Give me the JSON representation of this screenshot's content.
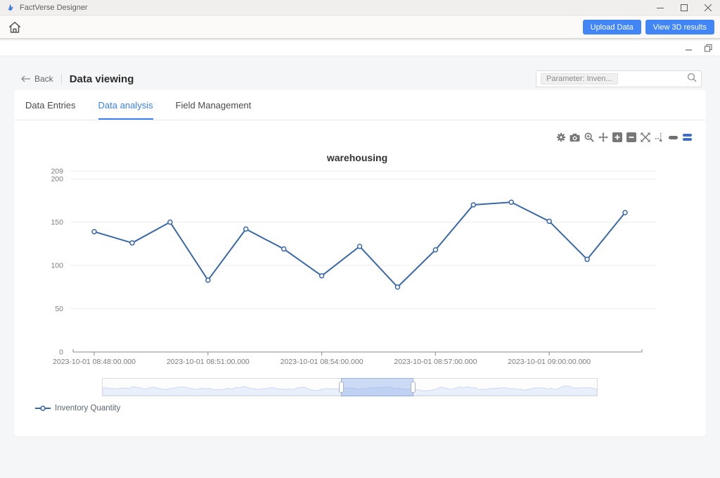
{
  "window": {
    "title": "FactVerse Designer"
  },
  "toolbar": {
    "upload_label": "Upload Data",
    "view3d_label": "View 3D results"
  },
  "header": {
    "back_label": "Back",
    "page_title": "Data viewing",
    "search_chip": "Parameter: Inven..."
  },
  "tabs": [
    {
      "label": "Data Entries"
    },
    {
      "label": "Data analysis"
    },
    {
      "label": "Field Management"
    }
  ],
  "modebar_icons": [
    "settings",
    "camera",
    "zoom",
    "pan",
    "zoom-in",
    "zoom-out",
    "autoscale",
    "toggle-spikelines",
    "hover-closest",
    "hover-compare"
  ],
  "colors": {
    "accent": "#4285f4",
    "active_tab": "#3b7ff0",
    "line": "#3a68a8",
    "grid": "#ededed",
    "axis": "#888888",
    "tick_text": "#7b7b7b"
  },
  "chart_data": {
    "type": "line",
    "title": "warehousing",
    "legend": "Inventory Quantity",
    "x": [
      "2023-10-01 08:48:00.000",
      "2023-10-01 08:49:00.000",
      "2023-10-01 08:50:00.000",
      "2023-10-01 08:51:00.000",
      "2023-10-01 08:52:00.000",
      "2023-10-01 08:53:00.000",
      "2023-10-01 08:54:00.000",
      "2023-10-01 08:55:00.000",
      "2023-10-01 08:56:00.000",
      "2023-10-01 08:57:00.000",
      "2023-10-01 08:58:00.000",
      "2023-10-01 08:59:00.000",
      "2023-10-01 09:00:00.000",
      "2023-10-01 09:01:00.000",
      "2023-10-01 09:02:00.000"
    ],
    "values": [
      139,
      126,
      150,
      83,
      142,
      119,
      88,
      122,
      75,
      118,
      170,
      173,
      151,
      107,
      161
    ],
    "ylim": [
      0,
      209
    ],
    "yticks": [
      0,
      50,
      100,
      150,
      200,
      209
    ],
    "xtick_indices": [
      0,
      3,
      6,
      9,
      12
    ],
    "xtick_labels": [
      "2023-10-01 08:48:00.000",
      "2023-10-01 08:51:00.000",
      "2023-10-01 08:54:00.000",
      "2023-10-01 08:57:00.000",
      "2023-10-01 09:00:00.000"
    ],
    "grid": true,
    "legend_position": "bottom-left",
    "line_color": "#3a68a8",
    "rangeslider": {
      "window_start": 0.482,
      "window_end": 0.629
    }
  }
}
